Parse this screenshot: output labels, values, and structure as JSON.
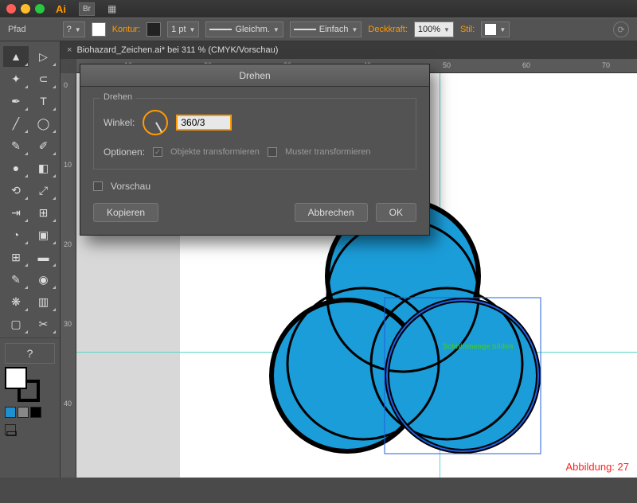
{
  "titlebar": {
    "app": "Ai",
    "bridge": "Br"
  },
  "ctrlbar": {
    "path_label": "Pfad",
    "q": "?",
    "stroke_label": "Kontur:",
    "stroke_val": "1 pt",
    "cap_label": "Gleichm.",
    "join_label": "Einfach",
    "opacity_label": "Deckkraft:",
    "opacity_val": "100%",
    "style_label": "Stil:"
  },
  "tab": {
    "close": "×",
    "title": "Biohazard_Zeichen.ai* bei 311 % (CMYK/Vorschau)"
  },
  "ruler_h": {
    "m1": "10",
    "m2": "20",
    "m3": "30",
    "m4": "40",
    "m5": "50",
    "m6": "60",
    "m7": "70"
  },
  "ruler_v": {
    "m0": "0",
    "m1": "10",
    "m2": "20",
    "m3": "30",
    "m4": "40"
  },
  "smart_guide": "Schnittmenge bilden",
  "figure_label": "Abbildung: 27",
  "dialog": {
    "title": "Drehen",
    "legend": "Drehen",
    "angle_label": "Winkel:",
    "angle_value": "360/3",
    "options_label": "Optionen:",
    "opt_objects": "Objekte transformieren",
    "opt_patterns": "Muster transformieren",
    "preview": "Vorschau",
    "copy": "Kopieren",
    "cancel": "Abbrechen",
    "ok": "OK"
  },
  "tools": {
    "question": "?"
  }
}
